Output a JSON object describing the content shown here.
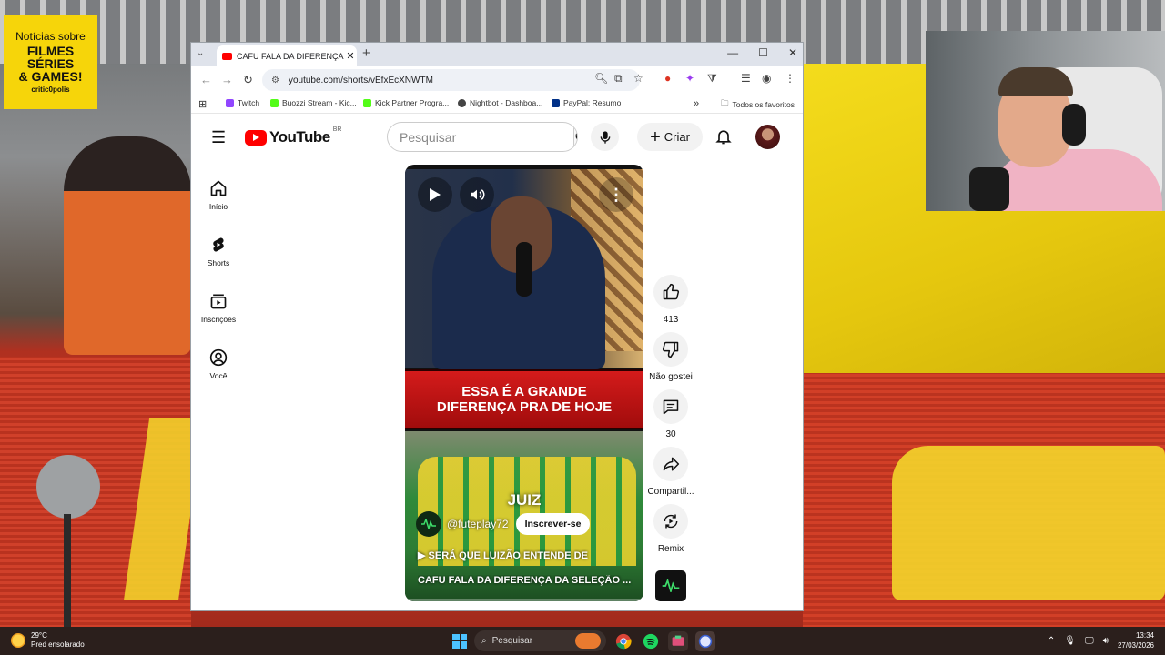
{
  "overlay": {
    "badge": {
      "line1": "Notícias sobre",
      "line2": "FILMES",
      "line3": "SÉRIES",
      "line4": "& GAMES!",
      "brand": "critic0polis"
    }
  },
  "browser": {
    "tab_title": "CAFU FALA DA DIFERENÇA DA",
    "url": "youtube.com/shorts/vEfxEcXNWTM",
    "bookmarks": [
      "Twitch",
      "Buozzi Stream - Kic...",
      "Kick Partner Progra...",
      "Nightbot - Dashboa...",
      "PayPal: Resumo"
    ],
    "all_bookmarks": "Todos os favoritos"
  },
  "youtube": {
    "logo_text": "YouTube",
    "country": "BR",
    "search_placeholder": "Pesquisar",
    "create_label": "Criar",
    "sidebar": [
      {
        "label": "Início",
        "icon": "home-icon"
      },
      {
        "label": "Shorts",
        "icon": "shorts-icon"
      },
      {
        "label": "Inscrições",
        "icon": "subscriptions-icon"
      },
      {
        "label": "Você",
        "icon": "you-icon"
      }
    ],
    "short": {
      "banner_line1": "ESSA É A GRANDE",
      "banner_line2": "DIFERENÇA PRA DE HOJE",
      "overlay_word": "JUIZ",
      "channel": "@futeplay72",
      "subscribe_label": "Inscrever-se",
      "title_line1": "SERÁ QUE LUIZÃO ENTENDE DE",
      "title_line2": "CAFU FALA DA DIFERENÇA DA SELEÇÃO ...",
      "progress": 0
    },
    "actions": {
      "like_count": "413",
      "dislike_label": "Não gostei",
      "comments_count": "30",
      "share_label": "Compartil...",
      "remix_label": "Remix"
    }
  },
  "taskbar": {
    "temp": "29°C",
    "weather": "Pred ensolarado",
    "search_label": "Pesquisar",
    "time": "13:34",
    "date": "27/03/2026"
  }
}
